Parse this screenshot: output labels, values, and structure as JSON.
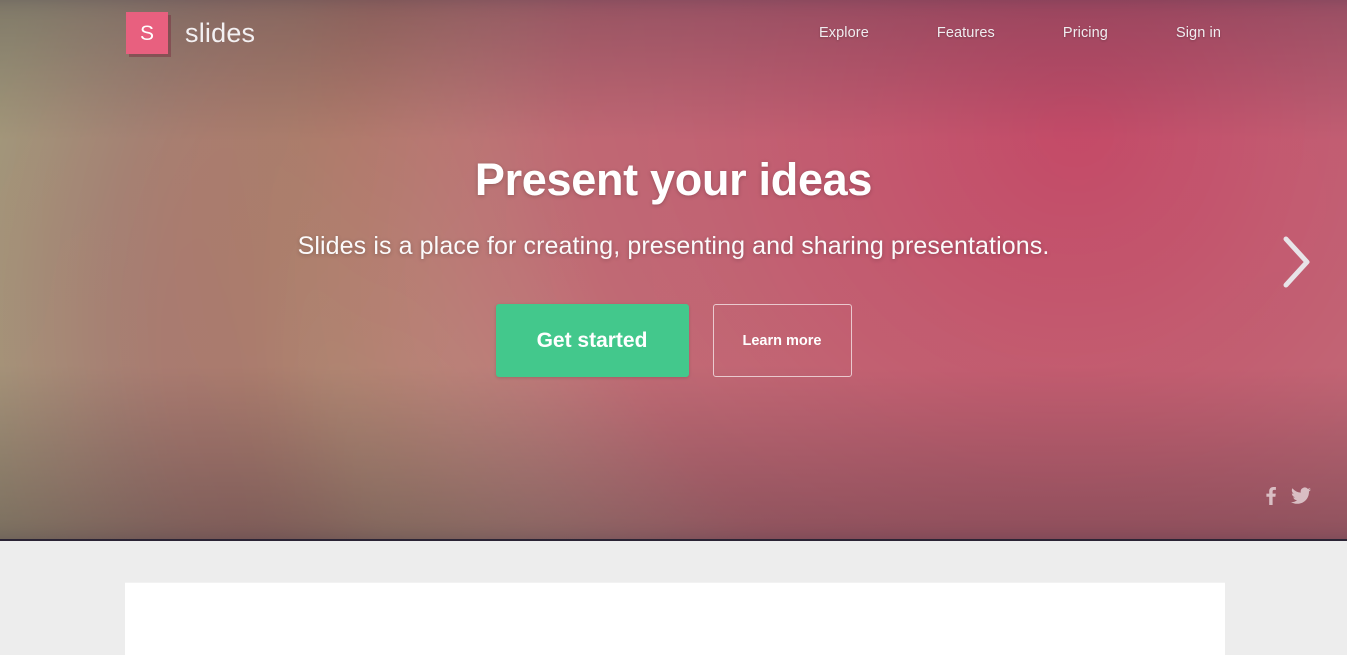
{
  "brand": {
    "mark_letter": "S",
    "name": "slides",
    "mark_color": "#e8607f"
  },
  "nav": {
    "items": [
      {
        "label": "Explore",
        "name": "nav-item-explore"
      },
      {
        "label": "Features",
        "name": "nav-item-features"
      },
      {
        "label": "Pricing",
        "name": "nav-item-pricing"
      },
      {
        "label": "Sign in",
        "name": "nav-item-sign-in"
      }
    ]
  },
  "hero": {
    "title": "Present your ideas",
    "subtitle": "Slides is a place for creating, presenting and sharing presentations.",
    "primary_cta": "Get started",
    "secondary_cta": "Learn more",
    "primary_cta_color": "#43c88c",
    "next_slide_icon": "chevron-right-icon"
  },
  "social": {
    "items": [
      {
        "label": "Facebook",
        "icon": "facebook-icon"
      },
      {
        "label": "Twitter",
        "icon": "twitter-icon"
      }
    ]
  },
  "below_fold": {
    "background_color": "#ededed",
    "card_color": "#ffffff"
  }
}
